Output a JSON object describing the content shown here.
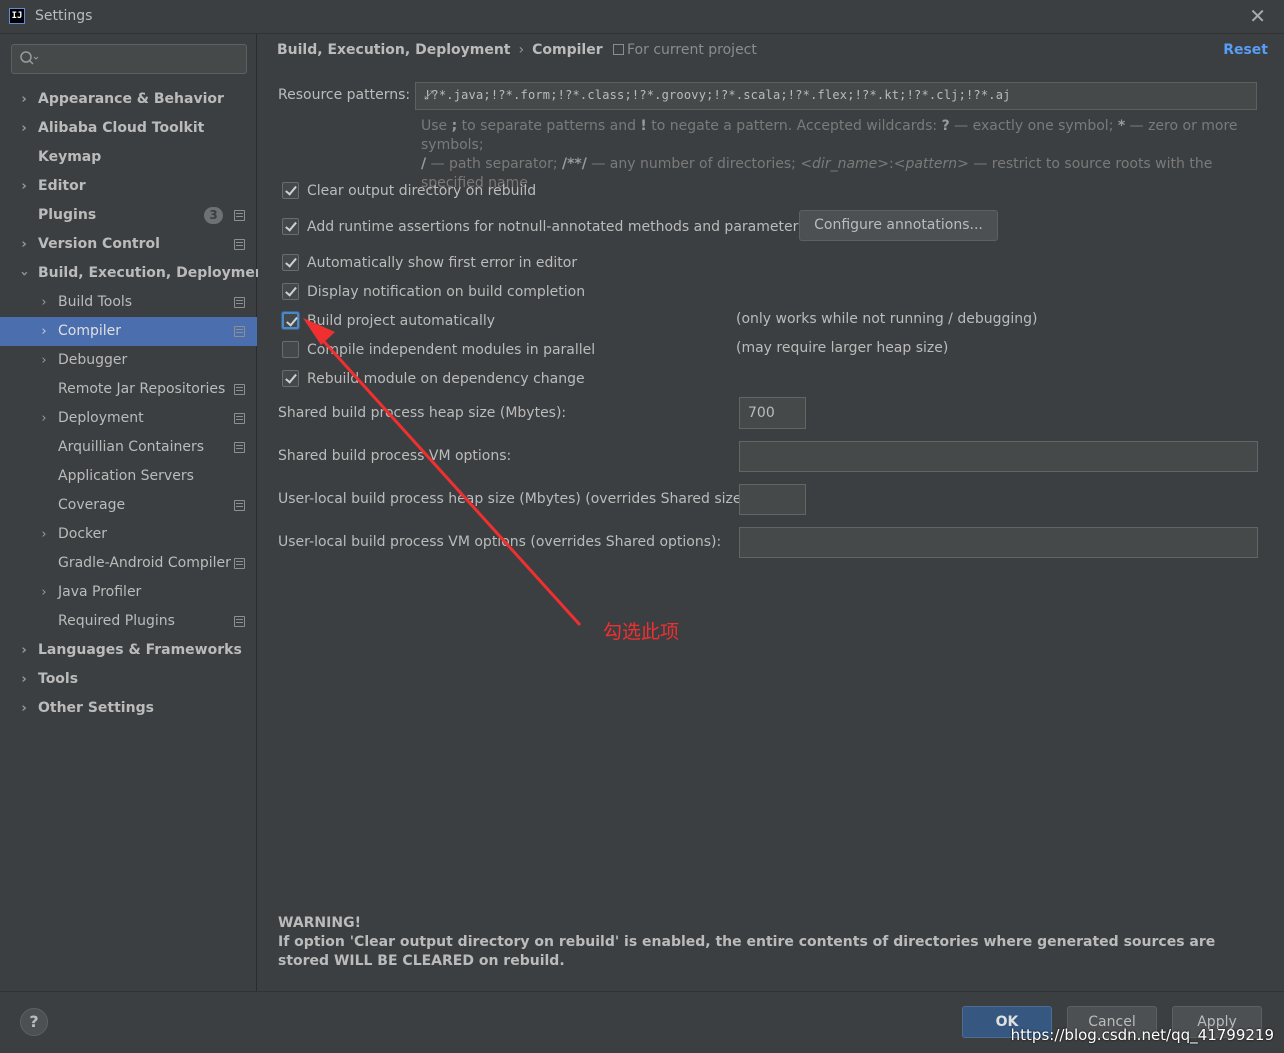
{
  "window": {
    "title": "Settings",
    "app_icon_text": "IJ"
  },
  "search": {
    "placeholder": "",
    "value": ""
  },
  "sidebar": {
    "items": [
      {
        "label": "Appearance & Behavior"
      },
      {
        "label": "Alibaba Cloud Toolkit"
      },
      {
        "label": "Keymap"
      },
      {
        "label": "Editor"
      },
      {
        "label": "Plugins",
        "badge": "3"
      },
      {
        "label": "Version Control"
      },
      {
        "label": "Build, Execution, Deployment"
      },
      {
        "label": "Build Tools"
      },
      {
        "label": "Compiler"
      },
      {
        "label": "Debugger"
      },
      {
        "label": "Remote Jar Repositories"
      },
      {
        "label": "Deployment"
      },
      {
        "label": "Arquillian Containers"
      },
      {
        "label": "Application Servers"
      },
      {
        "label": "Coverage"
      },
      {
        "label": "Docker"
      },
      {
        "label": "Gradle-Android Compiler"
      },
      {
        "label": "Java Profiler"
      },
      {
        "label": "Required Plugins"
      },
      {
        "label": "Languages & Frameworks"
      },
      {
        "label": "Tools"
      },
      {
        "label": "Other Settings"
      }
    ]
  },
  "header": {
    "breadcrumb_parent": "Build, Execution, Deployment",
    "breadcrumb_sep": "›",
    "breadcrumb_current": "Compiler",
    "scope": "For current project",
    "reset": "Reset"
  },
  "resource": {
    "label": "Resource patterns:",
    "value": "!?*.java;!?*.form;!?*.class;!?*.groovy;!?*.scala;!?*.flex;!?*.kt;!?*.clj;!?*.aj",
    "hint_1": "Use ",
    "hint_semicolon": ";",
    "hint_2": " to separate patterns and ",
    "hint_bang": "!",
    "hint_3": " to negate a pattern. Accepted wildcards: ",
    "hint_q": "?",
    "hint_4": " — exactly one symbol; ",
    "hint_star": "*",
    "hint_5": " — zero or more symbols;",
    "hint_slash": "/",
    "hint_6": " — path separator; ",
    "hint_dstar": "/**/",
    "hint_7": " — any number of directories; ",
    "hint_dir": "<dir_name>",
    "hint_colon": ":",
    "hint_pat": "<pattern>",
    "hint_8": " — restrict to source roots with the specified name"
  },
  "options": {
    "clear_output": {
      "label": "Clear output directory on rebuild",
      "checked": true
    },
    "runtime_assertions": {
      "label": "Add runtime assertions for notnull-annotated methods and parameters",
      "checked": true
    },
    "configure_annotations": "Configure annotations...",
    "show_first_error": {
      "label": "Automatically show first error in editor",
      "checked": true
    },
    "display_notification": {
      "label": "Display notification on build completion",
      "checked": true
    },
    "build_automatically": {
      "label": "Build project automatically",
      "checked": true,
      "note": "(only works while not running / debugging)"
    },
    "compile_parallel": {
      "label": "Compile independent modules in parallel",
      "checked": false,
      "note": "(may require larger heap size)"
    },
    "rebuild_on_change": {
      "label": "Rebuild module on dependency change",
      "checked": true
    }
  },
  "form": {
    "heap_label": "Shared build process heap size (Mbytes):",
    "heap_value": "700",
    "vm_label": "Shared build process VM options:",
    "vm_value": "",
    "user_heap_label": "User-local build process heap size (Mbytes) (overrides Shared size):",
    "user_heap_value": "",
    "user_vm_label": "User-local build process VM options (overrides Shared options):",
    "user_vm_value": ""
  },
  "annotation": {
    "text": "勾选此项",
    "color": "#f03030"
  },
  "warning": {
    "title": "WARNING!",
    "body": "If option 'Clear output directory on rebuild' is enabled, the entire contents of directories where generated sources are stored WILL BE CLEARED on rebuild."
  },
  "footer": {
    "help": "?",
    "ok": "OK",
    "cancel": "Cancel",
    "apply": "Apply",
    "watermark": "https://blog.csdn.net/qq_41799219"
  },
  "colors": {
    "background": "#3c3f41",
    "selection": "#4b6eaf",
    "link": "#589df6",
    "ok_button": "#365880"
  }
}
